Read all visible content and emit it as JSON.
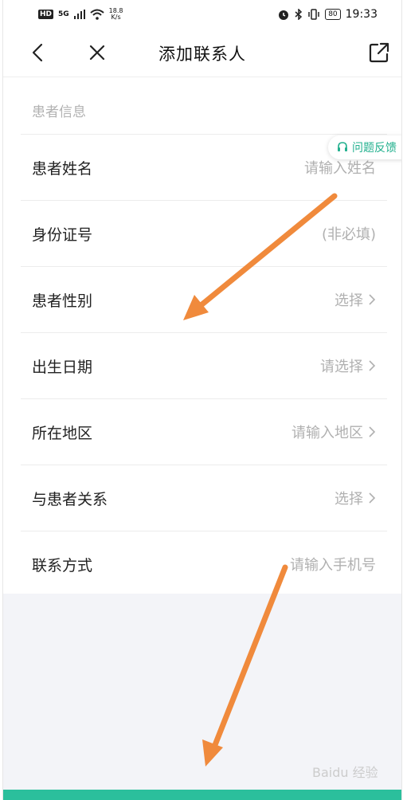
{
  "status_bar": {
    "hd": "HD",
    "network": "5G",
    "speed": "18.8",
    "speed_unit": "K/s",
    "battery": "80",
    "time": "19:33"
  },
  "header": {
    "title": "添加联系人",
    "back_icon": "chevron-left-icon",
    "close_icon": "close-icon",
    "share_icon": "external-link-icon"
  },
  "section_label": "患者信息",
  "feedback": {
    "label": "问题反馈",
    "icon": "headset-icon"
  },
  "fields": [
    {
      "label": "患者姓名",
      "value": "请输入姓名",
      "chevron": false
    },
    {
      "label": "身份证号",
      "value": "(非必填)",
      "chevron": false
    },
    {
      "label": "患者性别",
      "value": "选择",
      "chevron": true
    },
    {
      "label": "出生日期",
      "value": "请选择",
      "chevron": true
    },
    {
      "label": "所在地区",
      "value": "请输入地区",
      "chevron": true
    },
    {
      "label": "与患者关系",
      "value": "选择",
      "chevron": true
    },
    {
      "label": "联系方式",
      "value": "请输入手机号",
      "chevron": false
    }
  ],
  "watermark": "Baidu 经验",
  "colors": {
    "accent": "#2bbf9c",
    "annotation_arrow": "#f08a3c",
    "placeholder": "#b0b0b0",
    "background_gray": "#f3f4f8"
  }
}
